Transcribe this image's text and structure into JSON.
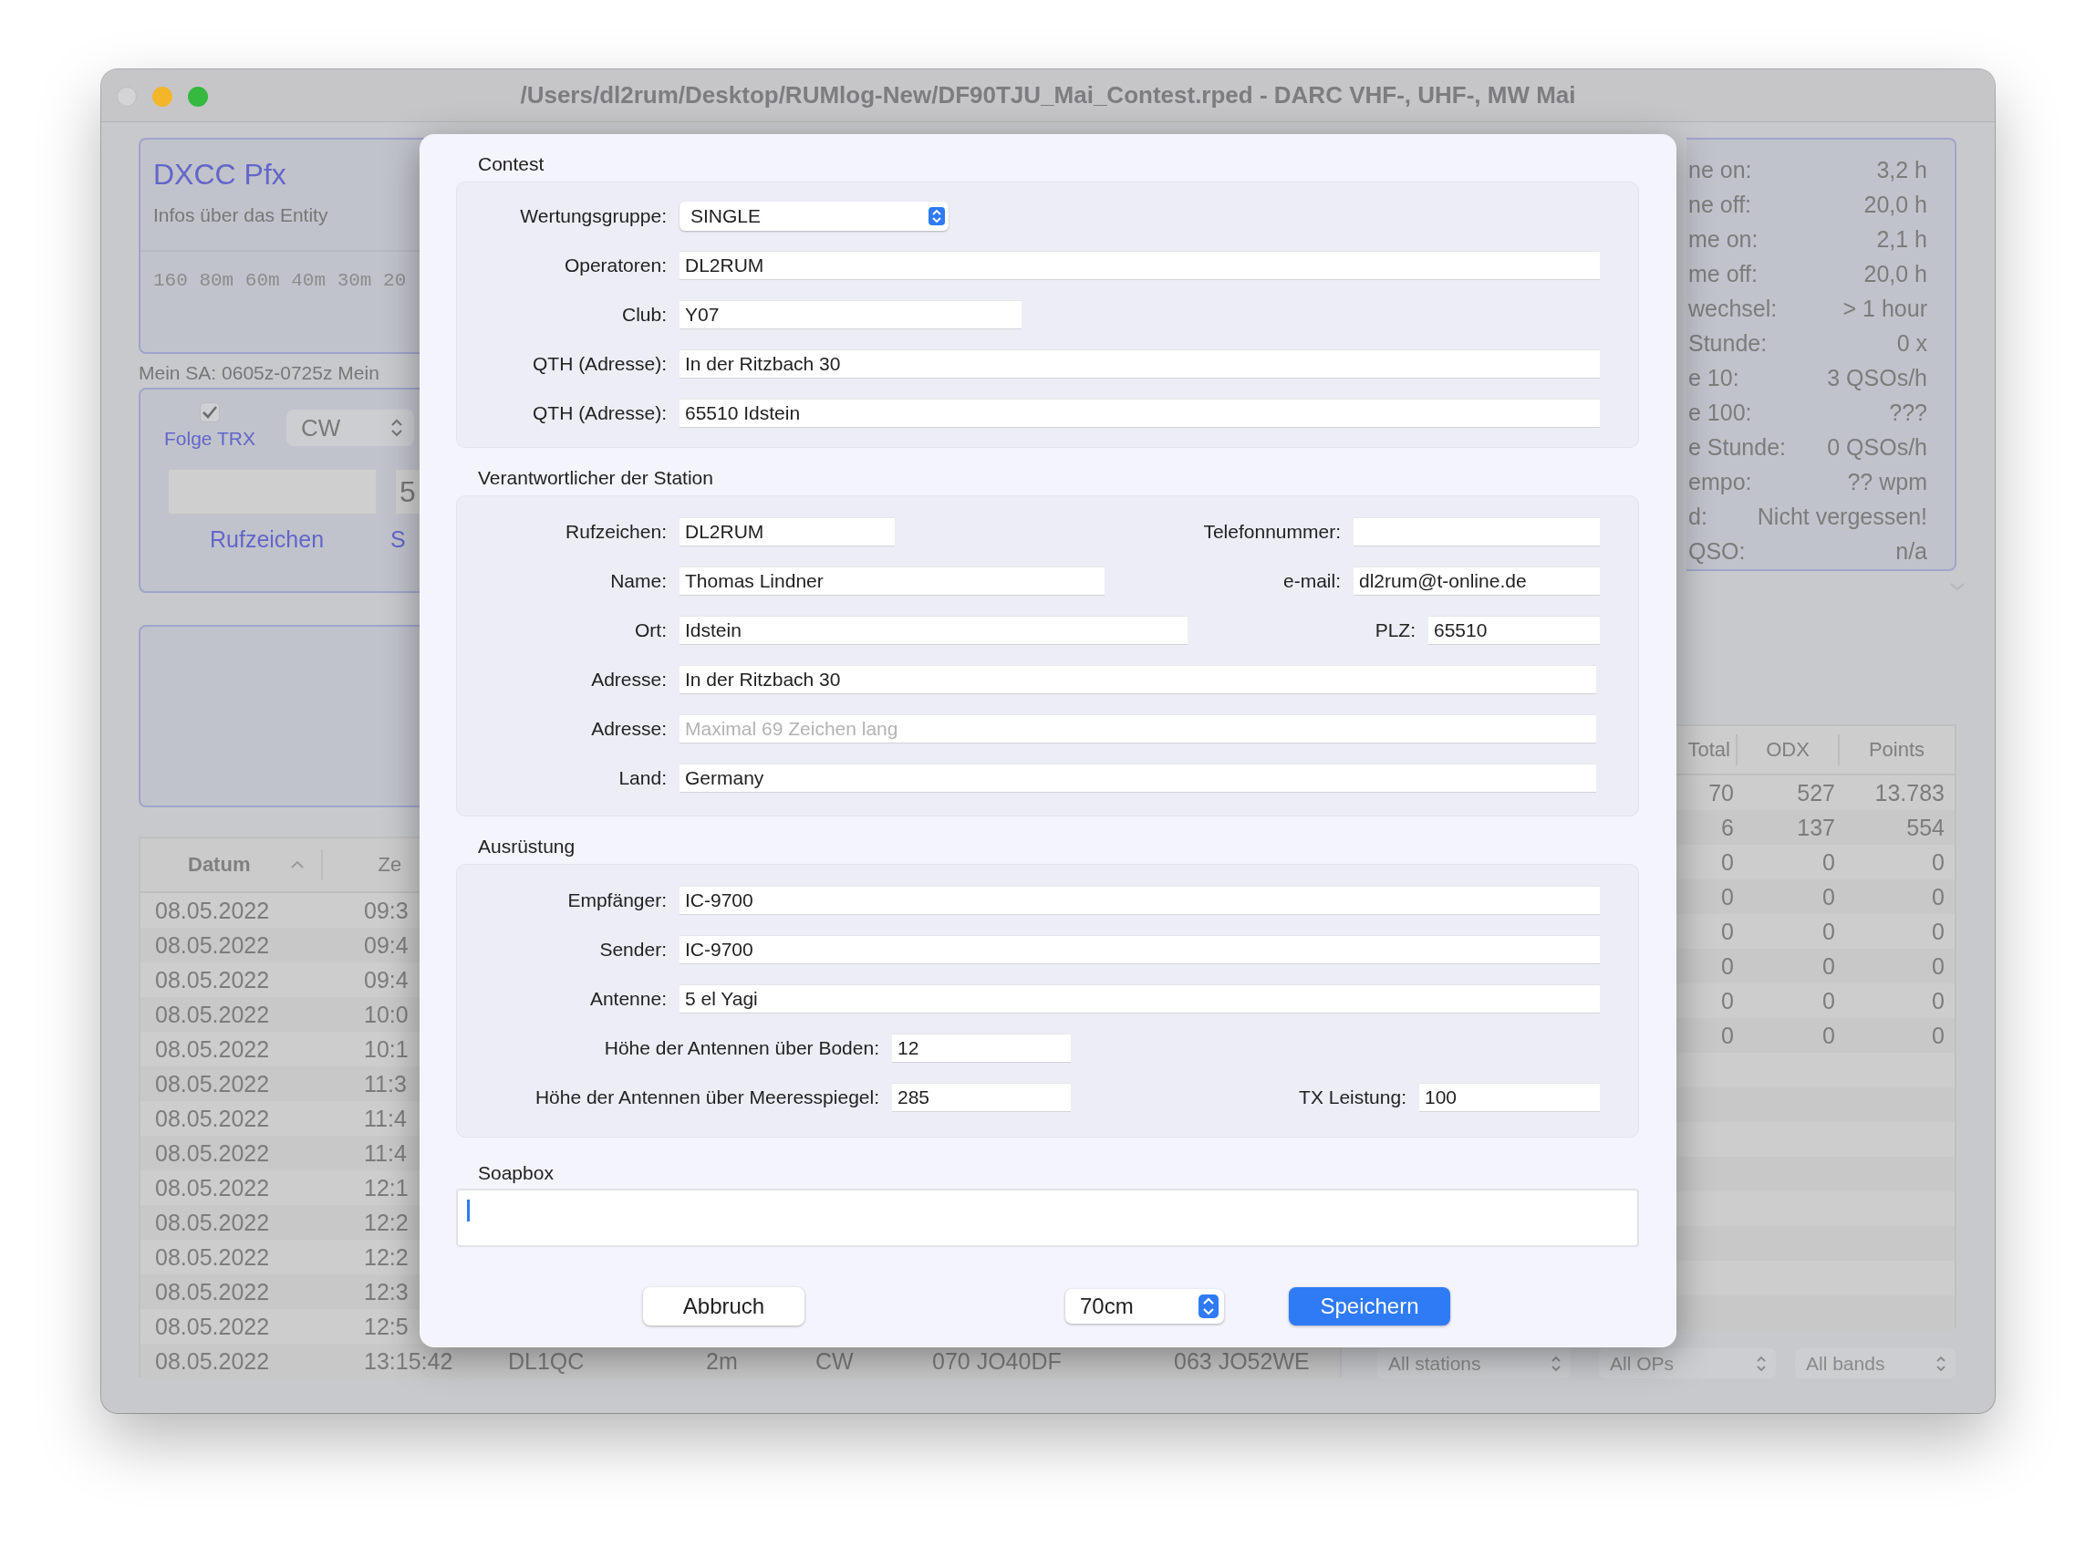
{
  "window": {
    "title": "/Users/dl2rum/Desktop/RUMlog-New/DF90TJU_Mai_Contest.rped - DARC VHF-, UHF-, MW  Mai"
  },
  "entity_panel": {
    "prefix": "DXCC Pfx",
    "info": "Infos über das Entity",
    "bands": "160 80m 60m 40m 30m 20"
  },
  "sa_line": "Mein SA: 0605z-0725z  Mein",
  "trx_panel": {
    "follow_trx": {
      "label": "Folge TRX",
      "checked": true
    },
    "mode": "CW",
    "report": "5",
    "call_label": "Rufzeichen",
    "column_2_label": "S"
  },
  "stats": [
    {
      "label": "ne on:",
      "value": "3,2 h"
    },
    {
      "label": "ne off:",
      "value": "20,0 h"
    },
    {
      "label": "me on:",
      "value": "2,1 h"
    },
    {
      "label": "me off:",
      "value": "20,0 h"
    },
    {
      "label": "wechsel:",
      "value": "> 1 hour"
    },
    {
      "label": "Stunde:",
      "value": "0 x"
    },
    {
      "label": "e 10:",
      "value": "3 QSOs/h"
    },
    {
      "label": "e 100:",
      "value": "???"
    },
    {
      "label": "e Stunde:",
      "value": "0 QSOs/h"
    },
    {
      "label": "empo:",
      "value": "?? wpm"
    },
    {
      "label": "d:",
      "value": "Nicht vergessen!"
    },
    {
      "label": "QSO:",
      "value": "n/a"
    }
  ],
  "log_table": {
    "columns": [
      "Datum",
      "Ze"
    ],
    "rows": [
      [
        "08.05.2022",
        "09:3"
      ],
      [
        "08.05.2022",
        "09:4"
      ],
      [
        "08.05.2022",
        "09:4"
      ],
      [
        "08.05.2022",
        "10:0"
      ],
      [
        "08.05.2022",
        "10:1"
      ],
      [
        "08.05.2022",
        "11:3"
      ],
      [
        "08.05.2022",
        "11:4"
      ],
      [
        "08.05.2022",
        "11:4"
      ],
      [
        "08.05.2022",
        "12:1"
      ],
      [
        "08.05.2022",
        "12:2"
      ],
      [
        "08.05.2022",
        "12:2"
      ],
      [
        "08.05.2022",
        "12:3"
      ],
      [
        "08.05.2022",
        "12:5"
      ],
      [
        "08.05.2022",
        "13:15:42",
        "DL1QC",
        "2m",
        "CW",
        "070 JO40DF",
        "063 JO52WE"
      ]
    ]
  },
  "band_table": {
    "columns": [
      "Total",
      "ODX",
      "Points"
    ],
    "rows": [
      [
        "70",
        "527",
        "13.783"
      ],
      [
        "6",
        "137",
        "554"
      ],
      [
        "0",
        "0",
        "0"
      ],
      [
        "0",
        "0",
        "0"
      ],
      [
        "0",
        "0",
        "0"
      ],
      [
        "0",
        "0",
        "0"
      ],
      [
        "0",
        "0",
        "0"
      ],
      [
        "0",
        "0",
        "0"
      ]
    ]
  },
  "filters": [
    "All stations",
    "All OPs",
    "All bands"
  ],
  "dialog": {
    "sections": [
      {
        "title": "Contest",
        "rows": [
          [
            {
              "label": "Wertungsgruppe:",
              "kind": "select",
              "value": "SINGLE"
            }
          ],
          [
            {
              "label": "Operatoren:",
              "value": "DL2RUM"
            }
          ],
          [
            {
              "label": "Club:",
              "value": "Y07"
            }
          ],
          [
            {
              "label": "QTH (Adresse):",
              "value": "In der Ritzbach 30"
            }
          ],
          [
            {
              "label": "QTH (Adresse):",
              "value": "65510 Idstein"
            }
          ]
        ]
      },
      {
        "title": "Verantwortlicher der Station",
        "rows": [
          [
            {
              "label": "Rufzeichen:",
              "value": "DL2RUM"
            },
            {
              "label": "Telefonnummer:"
            }
          ],
          [
            {
              "label": "Name:",
              "value": "Thomas Lindner"
            },
            {
              "label": "e-mail:",
              "value": "dl2rum@t-online.de"
            }
          ],
          [
            {
              "label": "Ort:",
              "value": "Idstein"
            },
            {
              "label": "PLZ:",
              "value": "65510"
            }
          ],
          [
            {
              "label": "Adresse:",
              "value": "In der Ritzbach 30"
            }
          ],
          [
            {
              "label": "Adresse:",
              "placeholder": "Maximal 69 Zeichen lang"
            }
          ],
          [
            {
              "label": "Land:",
              "value": "Germany"
            }
          ]
        ]
      },
      {
        "title": "Ausrüstung",
        "rows": [
          [
            {
              "label": "Empfänger:",
              "value": "IC-9700"
            }
          ],
          [
            {
              "label": "Sender:",
              "value": "IC-9700"
            }
          ],
          [
            {
              "label": "Antenne:",
              "value": "5 el Yagi"
            }
          ],
          [
            {
              "label": "Höhe der Antennen über Boden:",
              "value": "12"
            }
          ],
          [
            {
              "label": "Höhe der Antennen über Meeresspiegel:",
              "value": "285"
            },
            {
              "label": "TX Leistung:",
              "value": "100"
            }
          ]
        ]
      }
    ],
    "soapbox": {
      "label": "Soapbox"
    },
    "footer": [
      {
        "kind": "button",
        "label": "Abbruch"
      },
      {
        "kind": "select",
        "value": "70cm"
      },
      {
        "kind": "default",
        "label": "Speichern"
      }
    ]
  }
}
